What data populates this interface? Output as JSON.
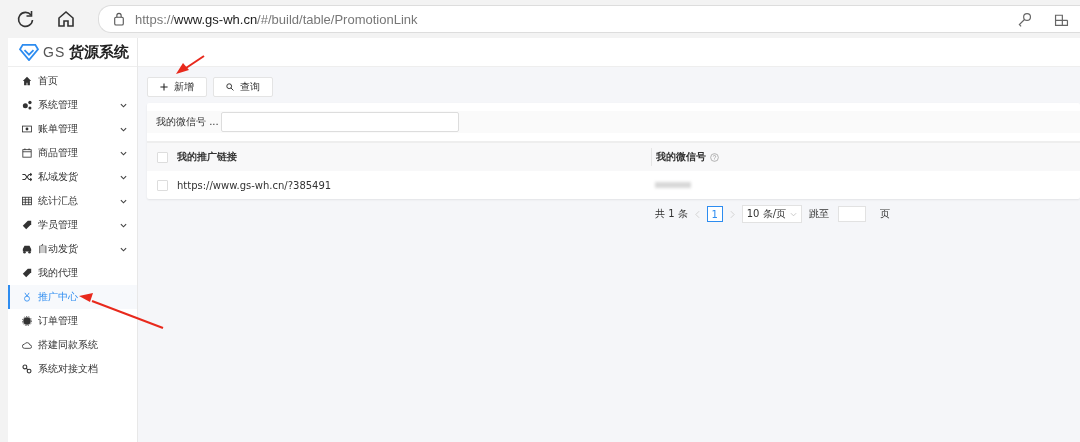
{
  "browser": {
    "url_host": "www.gs-wh.cn",
    "url_scheme": "https://",
    "url_path": "/#/build/table/PromotionLink"
  },
  "logo": {
    "prefix": "GS",
    "title": "货源系统"
  },
  "sidebar": {
    "items": [
      {
        "label": "首页",
        "submenu": false,
        "selected": false
      },
      {
        "label": "系统管理",
        "submenu": true,
        "selected": false
      },
      {
        "label": "账单管理",
        "submenu": true,
        "selected": false
      },
      {
        "label": "商品管理",
        "submenu": true,
        "selected": false
      },
      {
        "label": "私域发货",
        "submenu": true,
        "selected": false
      },
      {
        "label": "统计汇总",
        "submenu": true,
        "selected": false
      },
      {
        "label": "学员管理",
        "submenu": true,
        "selected": false
      },
      {
        "label": "自动发货",
        "submenu": true,
        "selected": false
      },
      {
        "label": "我的代理",
        "submenu": false,
        "selected": false
      },
      {
        "label": "推广中心",
        "submenu": false,
        "selected": true
      },
      {
        "label": "订单管理",
        "submenu": false,
        "selected": false
      },
      {
        "label": "搭建同款系统",
        "submenu": false,
        "selected": false
      },
      {
        "label": "系统对接文档",
        "submenu": false,
        "selected": false
      }
    ]
  },
  "toolbar": {
    "buttons": [
      {
        "label": "新增"
      },
      {
        "label": "查询"
      }
    ]
  },
  "filter": {
    "label": "我的微信号 ..."
  },
  "table": {
    "select_all_checked": false,
    "columns": [
      {
        "title": "我的推广链接",
        "help": false
      },
      {
        "title": "我的微信号",
        "help": true
      }
    ],
    "rows": [
      {
        "checked": false,
        "cells": [
          "https://www.gs-wh.cn/?385491",
          {
            "kind": "redacted"
          }
        ]
      }
    ]
  },
  "pagination": {
    "total": "共 1 条",
    "pages": [
      {
        "label": "1",
        "selected": true
      }
    ],
    "page_size": "10 条/页",
    "jump_label": "跳至",
    "page_unit": "页"
  }
}
